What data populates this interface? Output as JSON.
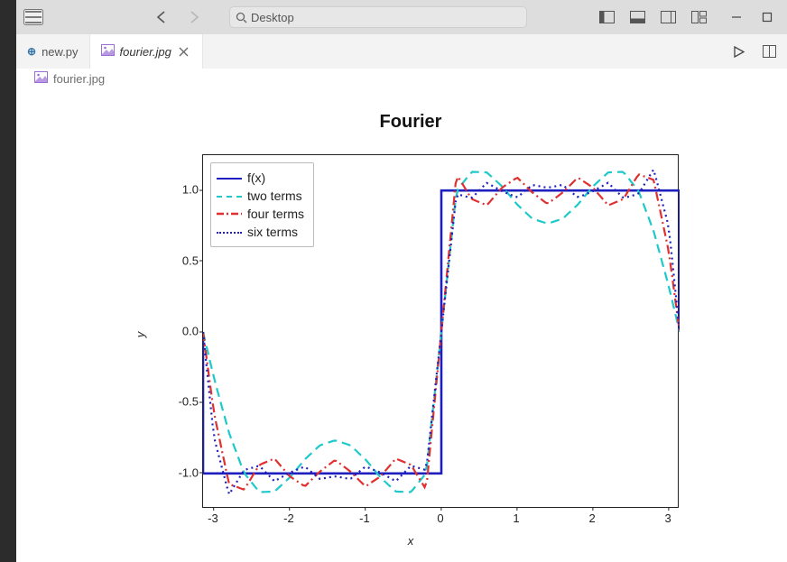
{
  "titlebar": {
    "search_label": "Desktop"
  },
  "tabs": [
    {
      "label": "new.py",
      "icon": "python-icon",
      "active": false,
      "closable": false
    },
    {
      "label": "fourier.jpg",
      "icon": "image-icon",
      "active": true,
      "closable": true
    }
  ],
  "breadcrumb": {
    "icon": "image-icon",
    "label": "fourier.jpg"
  },
  "chart_data": {
    "type": "line",
    "title": "Fourier",
    "xlabel": "x",
    "ylabel": "y",
    "xlim": [
      -3.1416,
      3.1416
    ],
    "ylim": [
      -1.25,
      1.25
    ],
    "xticks": [
      -3,
      -2,
      -1,
      0,
      1,
      2,
      3
    ],
    "yticks": [
      -1.0,
      -0.5,
      0.0,
      0.5,
      1.0
    ],
    "legend_position": "upper left",
    "x": [
      -3.1416,
      -3.0,
      -2.8,
      -2.6,
      -2.4,
      -2.2,
      -2.0,
      -1.8,
      -1.6,
      -1.4,
      -1.2,
      -1.0,
      -0.8,
      -0.6,
      -0.4,
      -0.2,
      0.0,
      0.2,
      0.4,
      0.6,
      0.8,
      1.0,
      1.2,
      1.4,
      1.6,
      1.8,
      2.0,
      2.2,
      2.4,
      2.6,
      2.8,
      3.0,
      3.1416
    ],
    "series": [
      {
        "name": "f(x)",
        "style": "solid",
        "color": "#1f1fbf",
        "values": [
          -1,
          -1,
          -1,
          -1,
          -1,
          -1,
          -1,
          -1,
          -1,
          -1,
          -1,
          -1,
          -1,
          -1,
          -1,
          -1,
          1,
          1,
          1,
          1,
          1,
          1,
          1,
          1,
          1,
          1,
          1,
          1,
          1,
          1,
          1,
          1,
          1
        ]
      },
      {
        "name": "two terms",
        "style": "dashed",
        "color": "#1fc9c9",
        "values": [
          0.0,
          -0.32,
          -0.712,
          -0.997,
          -1.132,
          -1.128,
          -1.03,
          -0.901,
          -0.801,
          -0.766,
          -0.801,
          -0.901,
          -1.03,
          -1.128,
          -1.132,
          -0.997,
          0.0,
          0.997,
          1.132,
          1.128,
          1.03,
          0.901,
          0.801,
          0.766,
          0.801,
          0.901,
          1.03,
          1.128,
          1.132,
          0.997,
          0.712,
          0.32,
          0.0
        ]
      },
      {
        "name": "four terms",
        "style": "dashdot",
        "color": "#e03030",
        "values": [
          0.0,
          -0.565,
          -1.075,
          -1.115,
          -0.94,
          -0.895,
          -1.02,
          -1.092,
          -0.986,
          -0.905,
          -0.986,
          -1.092,
          -1.02,
          -0.895,
          -0.94,
          -1.115,
          0.0,
          1.115,
          0.94,
          0.895,
          1.02,
          1.092,
          0.986,
          0.905,
          0.986,
          1.092,
          1.02,
          0.895,
          0.94,
          1.115,
          1.075,
          0.565,
          0.0
        ]
      },
      {
        "name": "six terms",
        "style": "dotted",
        "color": "#1f1fbf",
        "values": [
          0.0,
          -0.74,
          -1.15,
          -0.976,
          -0.946,
          -1.055,
          -0.995,
          -0.951,
          -1.04,
          -1.02,
          -1.04,
          -0.951,
          -0.995,
          -1.055,
          -0.946,
          -0.976,
          0.0,
          0.976,
          0.946,
          1.055,
          0.995,
          0.951,
          1.04,
          1.02,
          1.04,
          0.951,
          0.995,
          1.055,
          0.946,
          0.976,
          1.15,
          0.74,
          0.0
        ]
      }
    ]
  }
}
